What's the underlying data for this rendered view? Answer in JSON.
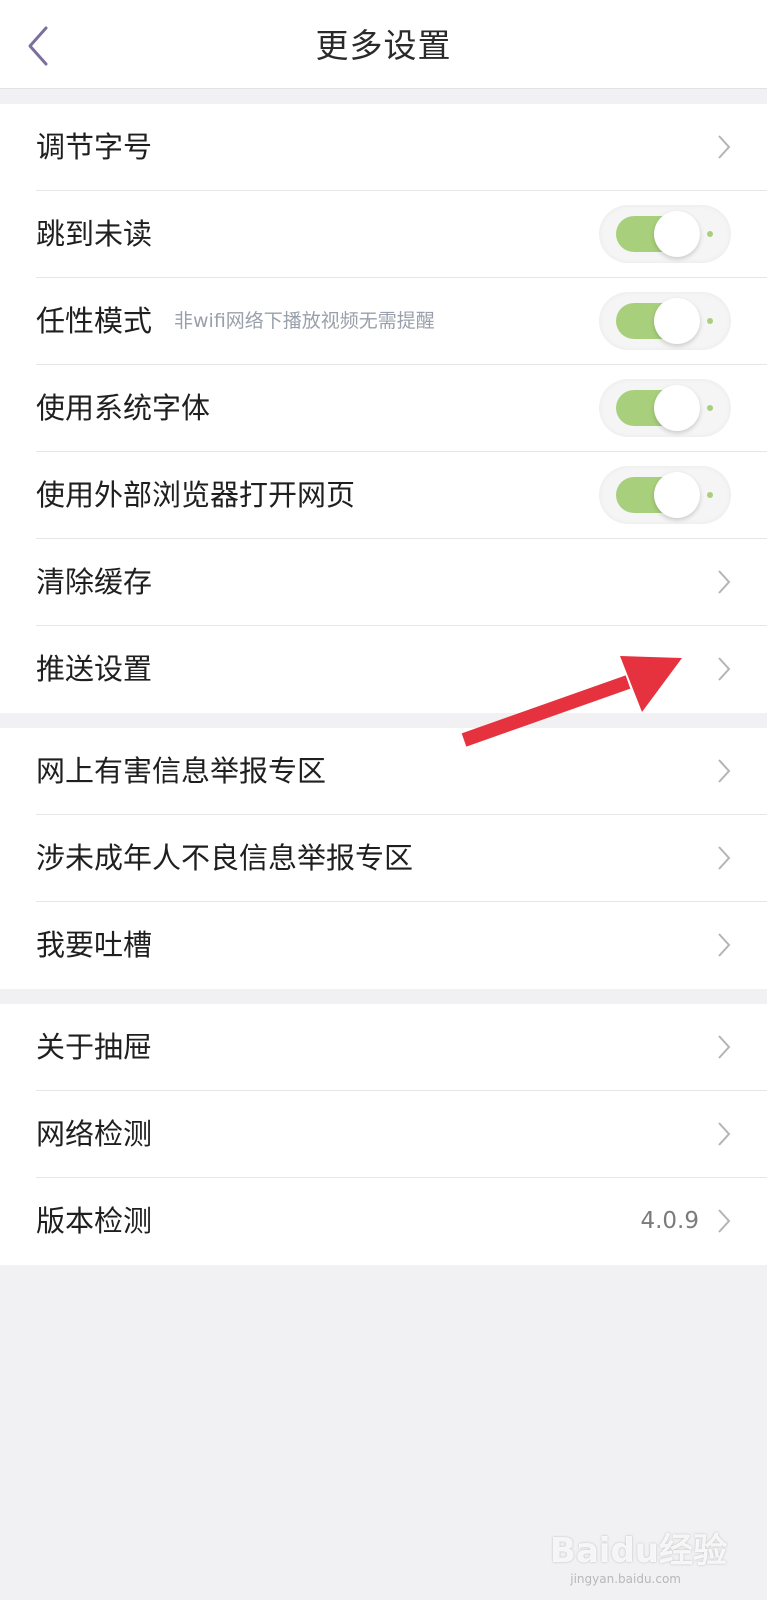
{
  "header": {
    "title": "更多设置",
    "back_icon": "chevron-left-icon"
  },
  "colors": {
    "toggle_on": "#a8d07c",
    "back_icon": "#7b6fa0",
    "annotation_arrow": "#e5323e"
  },
  "groups": [
    {
      "items": [
        {
          "label": "调节字号",
          "type": "link"
        },
        {
          "label": "跳到未读",
          "type": "toggle",
          "on": true
        },
        {
          "label": "任性模式",
          "hint": "非wifi网络下播放视频无需提醒",
          "type": "toggle",
          "on": true
        },
        {
          "label": "使用系统字体",
          "type": "toggle",
          "on": true
        },
        {
          "label": "使用外部浏览器打开网页",
          "type": "toggle",
          "on": true
        },
        {
          "label": "清除缓存",
          "type": "link"
        },
        {
          "label": "推送设置",
          "type": "link"
        }
      ]
    },
    {
      "items": [
        {
          "label": "网上有害信息举报专区",
          "type": "link"
        },
        {
          "label": "涉未成年人不良信息举报专区",
          "type": "link"
        },
        {
          "label": "我要吐槽",
          "type": "link"
        }
      ]
    },
    {
      "items": [
        {
          "label": "关于抽屉",
          "type": "link"
        },
        {
          "label": "网络检测",
          "type": "link"
        },
        {
          "label": "版本检测",
          "value": "4.0.9",
          "type": "link"
        }
      ]
    }
  ],
  "watermark": {
    "text": "Baidu经验",
    "sub": "jingyan.baidu.com"
  }
}
